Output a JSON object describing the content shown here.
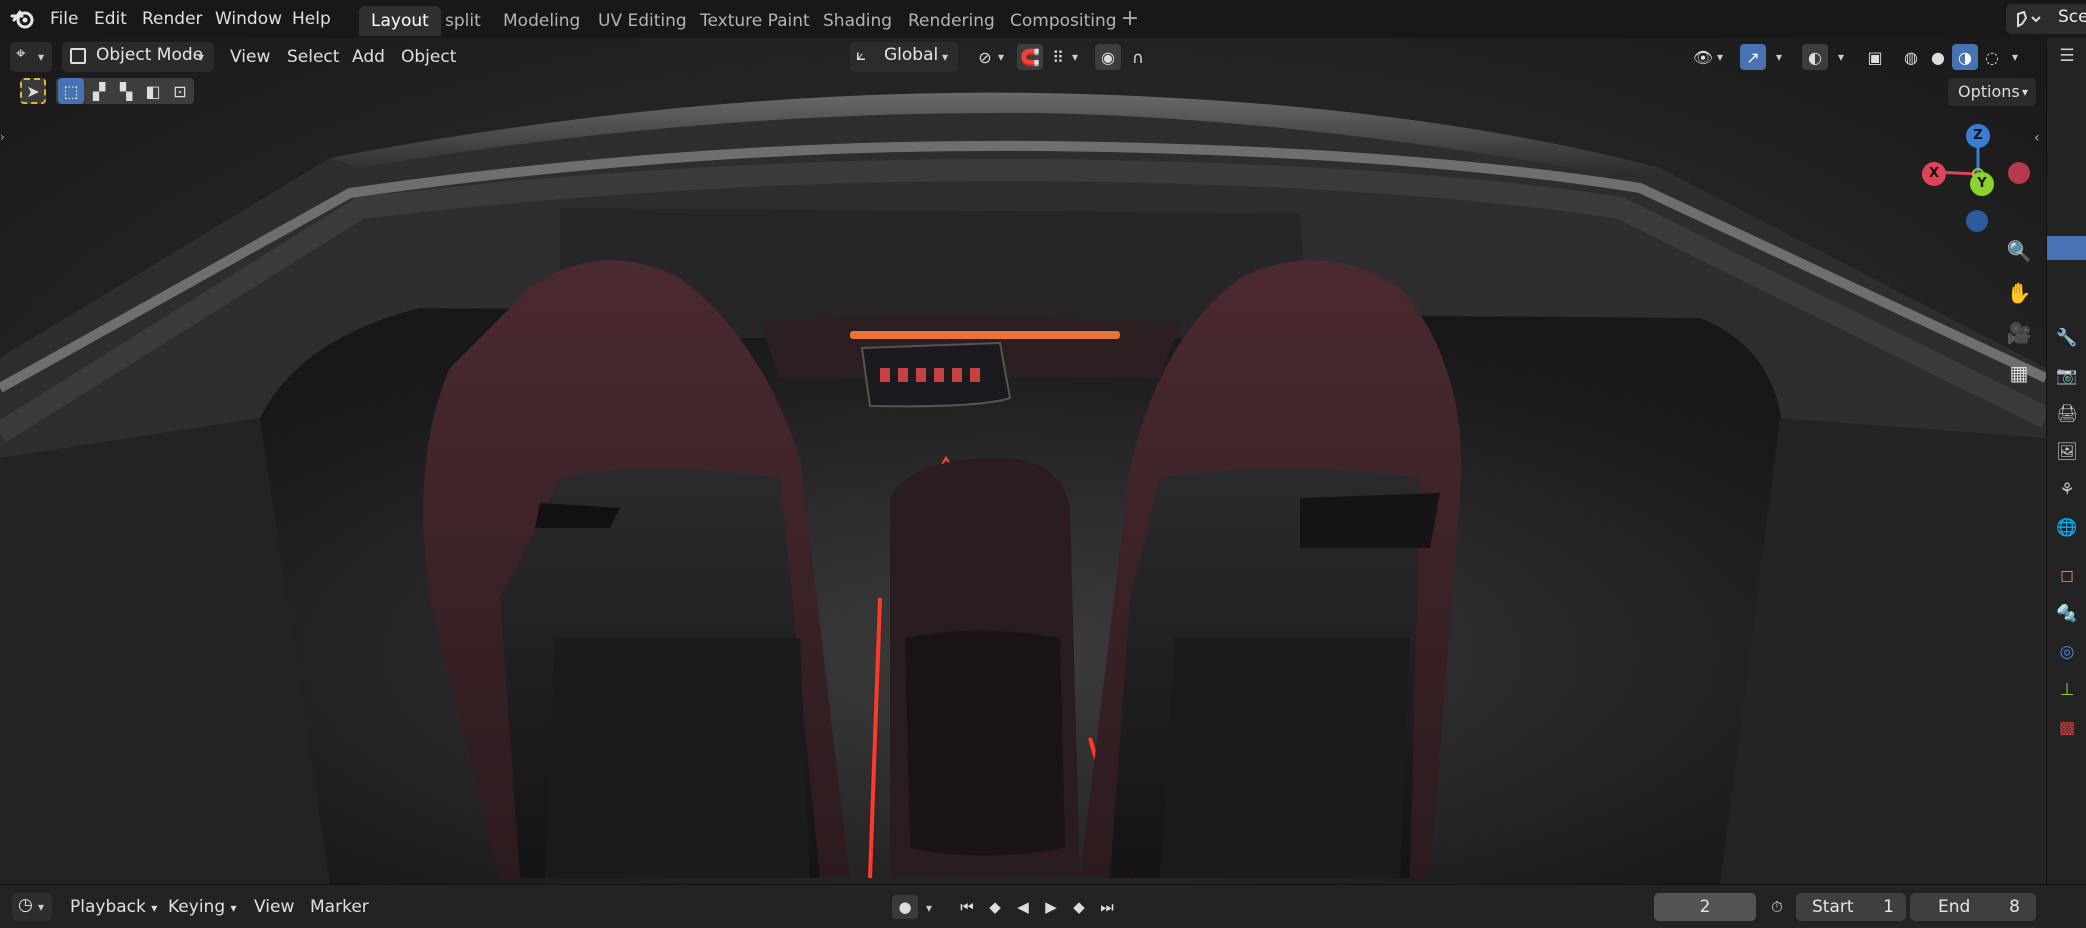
{
  "topbar": {
    "menus": [
      "File",
      "Edit",
      "Render",
      "Window",
      "Help"
    ],
    "workspaces": [
      "Layout",
      "split",
      "Modeling",
      "UV Editing",
      "Texture Paint",
      "Shading",
      "Rendering",
      "Compositing"
    ],
    "active_workspace": "Layout",
    "add_workspace": "+",
    "scene_label": "Sce"
  },
  "viewport_header": {
    "mode": "Object Mode",
    "menus": [
      "View",
      "Select",
      "Add",
      "Object"
    ],
    "orientation": "Global",
    "options": "Options"
  },
  "gizmo": {
    "z": "Z",
    "x": "X",
    "y": "Y"
  },
  "timeline": {
    "menus": [
      "Playback",
      "Keying",
      "View",
      "Marker"
    ],
    "current_frame": "2",
    "start_label": "Start",
    "start_value": "1",
    "end_label": "End",
    "end_value": "8"
  },
  "colors": {
    "accent": "#4772b3",
    "axis_x": "#e0445a",
    "axis_y": "#8bd32b",
    "axis_z": "#3a7dd6"
  }
}
